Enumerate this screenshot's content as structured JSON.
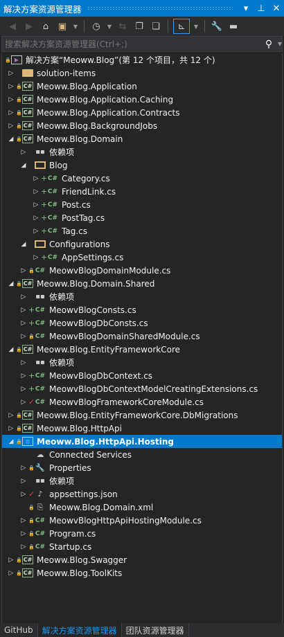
{
  "window": {
    "title": "解决方案资源管理器",
    "dropdown_icon": "chevron-down-icon",
    "pin_icon": "pin-icon",
    "close_icon": "close-icon"
  },
  "toolbar": [
    "back-icon",
    "forward-icon",
    "home-icon",
    "switch-views-icon",
    "pending-changes-filter-icon",
    "sync-icon",
    "collapse-all-icon",
    "show-all-files-icon",
    "track-active-item-icon",
    "properties-icon",
    "preview-icon"
  ],
  "search": {
    "placeholder": "搜索解决方案资源管理器(Ctrl+;)"
  },
  "colors": {
    "accent": "#007acc",
    "background": "#252526",
    "added": "#7ec27e",
    "checked_out": "#e03c3c",
    "locked": "#4fa3e0"
  },
  "tree": [
    {
      "level": -1,
      "exp": "",
      "pre": "lock",
      "icon": "sol",
      "label": "解决方案“Meoww.Blog”(第 12 个项目，共 12 个)"
    },
    {
      "level": 0,
      "exp": "c",
      "pre": "",
      "icon": "folder",
      "label": "solution-items"
    },
    {
      "level": 0,
      "exp": "c",
      "pre": "lock",
      "icon": "proj",
      "label": "Meoww.Blog.Application"
    },
    {
      "level": 0,
      "exp": "c",
      "pre": "lock",
      "icon": "proj",
      "label": "Meoww.Blog.Application.Caching"
    },
    {
      "level": 0,
      "exp": "c",
      "pre": "lock",
      "icon": "proj",
      "label": "Meoww.Blog.Application.Contracts"
    },
    {
      "level": 0,
      "exp": "c",
      "pre": "lock",
      "icon": "proj",
      "label": "Meoww.Blog.BackgroundJobs"
    },
    {
      "level": 0,
      "exp": "e",
      "pre": "lock",
      "icon": "proj",
      "label": "Meoww.Blog.Domain"
    },
    {
      "level": 1,
      "exp": "c",
      "pre": "",
      "icon": "deps",
      "label": "依赖项"
    },
    {
      "level": 1,
      "exp": "e",
      "pre": "",
      "icon": "folderopen",
      "label": "Blog"
    },
    {
      "level": 2,
      "exp": "c",
      "pre": "plus",
      "icon": "cs",
      "label": "Category.cs"
    },
    {
      "level": 2,
      "exp": "c",
      "pre": "plus",
      "icon": "cs",
      "label": "FriendLink.cs"
    },
    {
      "level": 2,
      "exp": "c",
      "pre": "plus",
      "icon": "cs",
      "label": "Post.cs"
    },
    {
      "level": 2,
      "exp": "c",
      "pre": "plus",
      "icon": "cs",
      "label": "PostTag.cs"
    },
    {
      "level": 2,
      "exp": "c",
      "pre": "plus",
      "icon": "cs",
      "label": "Tag.cs"
    },
    {
      "level": 1,
      "exp": "e",
      "pre": "",
      "icon": "folderopen",
      "label": "Configurations"
    },
    {
      "level": 2,
      "exp": "c",
      "pre": "plus",
      "icon": "cs",
      "label": "AppSettings.cs"
    },
    {
      "level": 1,
      "exp": "c",
      "pre": "lock",
      "icon": "cs",
      "label": "MeowvBlogDomainModule.cs"
    },
    {
      "level": 0,
      "exp": "e",
      "pre": "lock",
      "icon": "proj",
      "label": "Meoww.Blog.Domain.Shared"
    },
    {
      "level": 1,
      "exp": "c",
      "pre": "",
      "icon": "deps",
      "label": "依赖项"
    },
    {
      "level": 1,
      "exp": "c",
      "pre": "plus",
      "icon": "cs",
      "label": "MeowvBlogConsts.cs"
    },
    {
      "level": 1,
      "exp": "c",
      "pre": "plus",
      "icon": "cs",
      "label": "MeowvBlogDbConsts.cs"
    },
    {
      "level": 1,
      "exp": "c",
      "pre": "lock",
      "icon": "cs",
      "label": "MeowvBlogDomainSharedModule.cs"
    },
    {
      "level": 0,
      "exp": "e",
      "pre": "lock",
      "icon": "proj",
      "label": "Meoww.Blog.EntityFrameworkCore"
    },
    {
      "level": 1,
      "exp": "c",
      "pre": "",
      "icon": "deps",
      "label": "依赖项"
    },
    {
      "level": 1,
      "exp": "c",
      "pre": "plus",
      "icon": "cs",
      "label": "MeowvBlogDbContext.cs"
    },
    {
      "level": 1,
      "exp": "c",
      "pre": "plus",
      "icon": "cs",
      "label": "MeowvBlogDbContextModelCreatingExtensions.cs"
    },
    {
      "level": 1,
      "exp": "c",
      "pre": "check",
      "icon": "cs",
      "label": "MeowvBlogFrameworkCoreModule.cs"
    },
    {
      "level": 0,
      "exp": "c",
      "pre": "lock",
      "icon": "proj",
      "label": "Meoww.Blog.EntityFrameworkCore.DbMigrations"
    },
    {
      "level": 0,
      "exp": "c",
      "pre": "lock",
      "icon": "proj",
      "label": "Meoww.Blog.HttpApi"
    },
    {
      "level": 0,
      "exp": "e",
      "pre": "lock",
      "icon": "web",
      "label": "Meoww.Blog.HttpApi.Hosting",
      "selected": true
    },
    {
      "level": 1,
      "exp": "",
      "pre": "",
      "icon": "cloud",
      "label": "Connected Services"
    },
    {
      "level": 1,
      "exp": "c",
      "pre": "lock",
      "icon": "wrench",
      "label": "Properties"
    },
    {
      "level": 1,
      "exp": "c",
      "pre": "",
      "icon": "deps",
      "label": "依赖项"
    },
    {
      "level": 1,
      "exp": "c",
      "pre": "check",
      "icon": "json",
      "label": "appsettings.json"
    },
    {
      "level": 1,
      "exp": "",
      "pre": "lock",
      "icon": "xml",
      "label": "Meoww.Blog.Domain.xml"
    },
    {
      "level": 1,
      "exp": "c",
      "pre": "lock",
      "icon": "cs",
      "label": "MeowvBlogHttpApiHostingModule.cs"
    },
    {
      "level": 1,
      "exp": "c",
      "pre": "lock",
      "icon": "cs",
      "label": "Program.cs"
    },
    {
      "level": 1,
      "exp": "c",
      "pre": "lock",
      "icon": "cs",
      "label": "Startup.cs"
    },
    {
      "level": 0,
      "exp": "c",
      "pre": "lock",
      "icon": "proj",
      "label": "Meoww.Blog.Swagger"
    },
    {
      "level": 0,
      "exp": "c",
      "pre": "lock",
      "icon": "proj",
      "label": "Meoww.Blog.ToolKits"
    }
  ],
  "tabs": [
    {
      "label": "GitHub"
    },
    {
      "label": "解决方案资源管理器",
      "active": true
    },
    {
      "label": "团队资源管理器"
    }
  ]
}
